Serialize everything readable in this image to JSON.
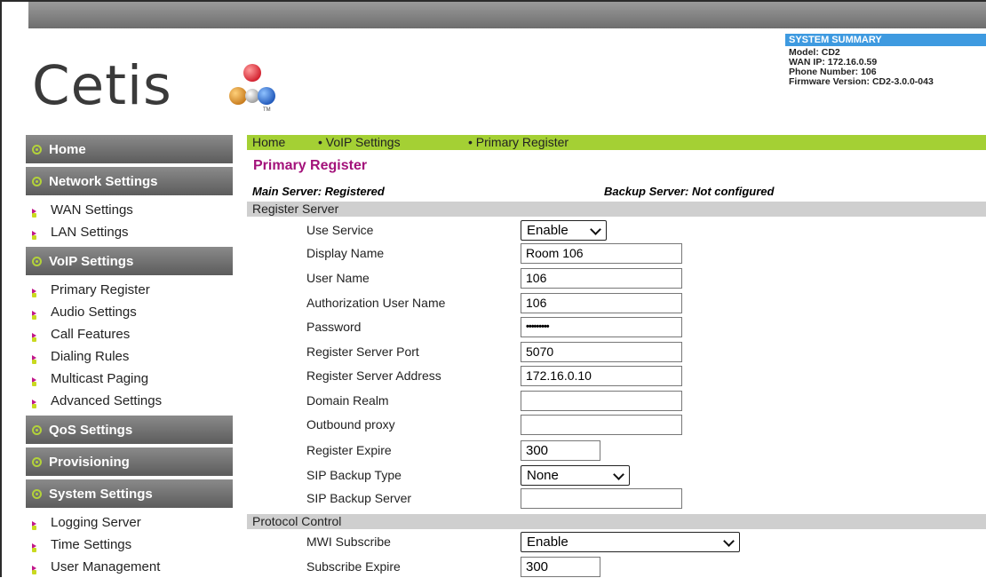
{
  "logo": {
    "text": "Cetis",
    "tm": "TM"
  },
  "summary": {
    "title": "SYSTEM SUMMARY",
    "model": "Model: CD2",
    "wan_ip": "WAN IP: 172.16.0.59",
    "phone": "Phone Number: 106",
    "firmware": "Firmware Version: CD2-3.0.0-043"
  },
  "sidebar": {
    "home": "Home",
    "network": "Network Settings",
    "wan": "WAN Settings",
    "lan": "LAN Settings",
    "voip": "VoIP Settings",
    "primary": "Primary Register",
    "audio": "Audio Settings",
    "call": "Call Features",
    "dialing": "Dialing Rules",
    "multicast": "Multicast Paging",
    "advanced": "Advanced Settings",
    "qos": "QoS Settings",
    "provisioning": "Provisioning",
    "system": "System Settings",
    "logging": "Logging Server",
    "time": "Time Settings",
    "user_mgmt": "User Management"
  },
  "breadcrumb": {
    "home": "Home",
    "voip": "• VoIP Settings",
    "primary": "• Primary Register"
  },
  "page": {
    "title": "Primary Register",
    "main_status": "Main Server: Registered",
    "backup_status": "Backup Server: Not configured"
  },
  "register_section": "Register Server",
  "fields": {
    "use_service": {
      "label": "Use Service",
      "value": "Enable"
    },
    "display_name": {
      "label": "Display Name",
      "value": "Room 106"
    },
    "user_name": {
      "label": "User Name",
      "value": "106"
    },
    "auth_user": {
      "label": "Authorization User Name",
      "value": "106"
    },
    "password": {
      "label": "Password",
      "value": "•••••••••"
    },
    "reg_port": {
      "label": "Register Server Port",
      "value": "5070"
    },
    "reg_addr": {
      "label": "Register Server Address",
      "value": "172.16.0.10"
    },
    "domain": {
      "label": "Domain Realm",
      "value": ""
    },
    "outbound": {
      "label": "Outbound proxy",
      "value": ""
    },
    "expire": {
      "label": "Register Expire",
      "value": "300"
    },
    "backup_type": {
      "label": "SIP Backup Type",
      "value": "None"
    },
    "backup_server": {
      "label": "SIP Backup Server",
      "value": ""
    },
    "mwi": {
      "label": "MWI Subscribe",
      "value": "Enable"
    },
    "sub_expire": {
      "label": "Subscribe Expire",
      "value": "300"
    }
  },
  "protocol_section": "Protocol Control"
}
